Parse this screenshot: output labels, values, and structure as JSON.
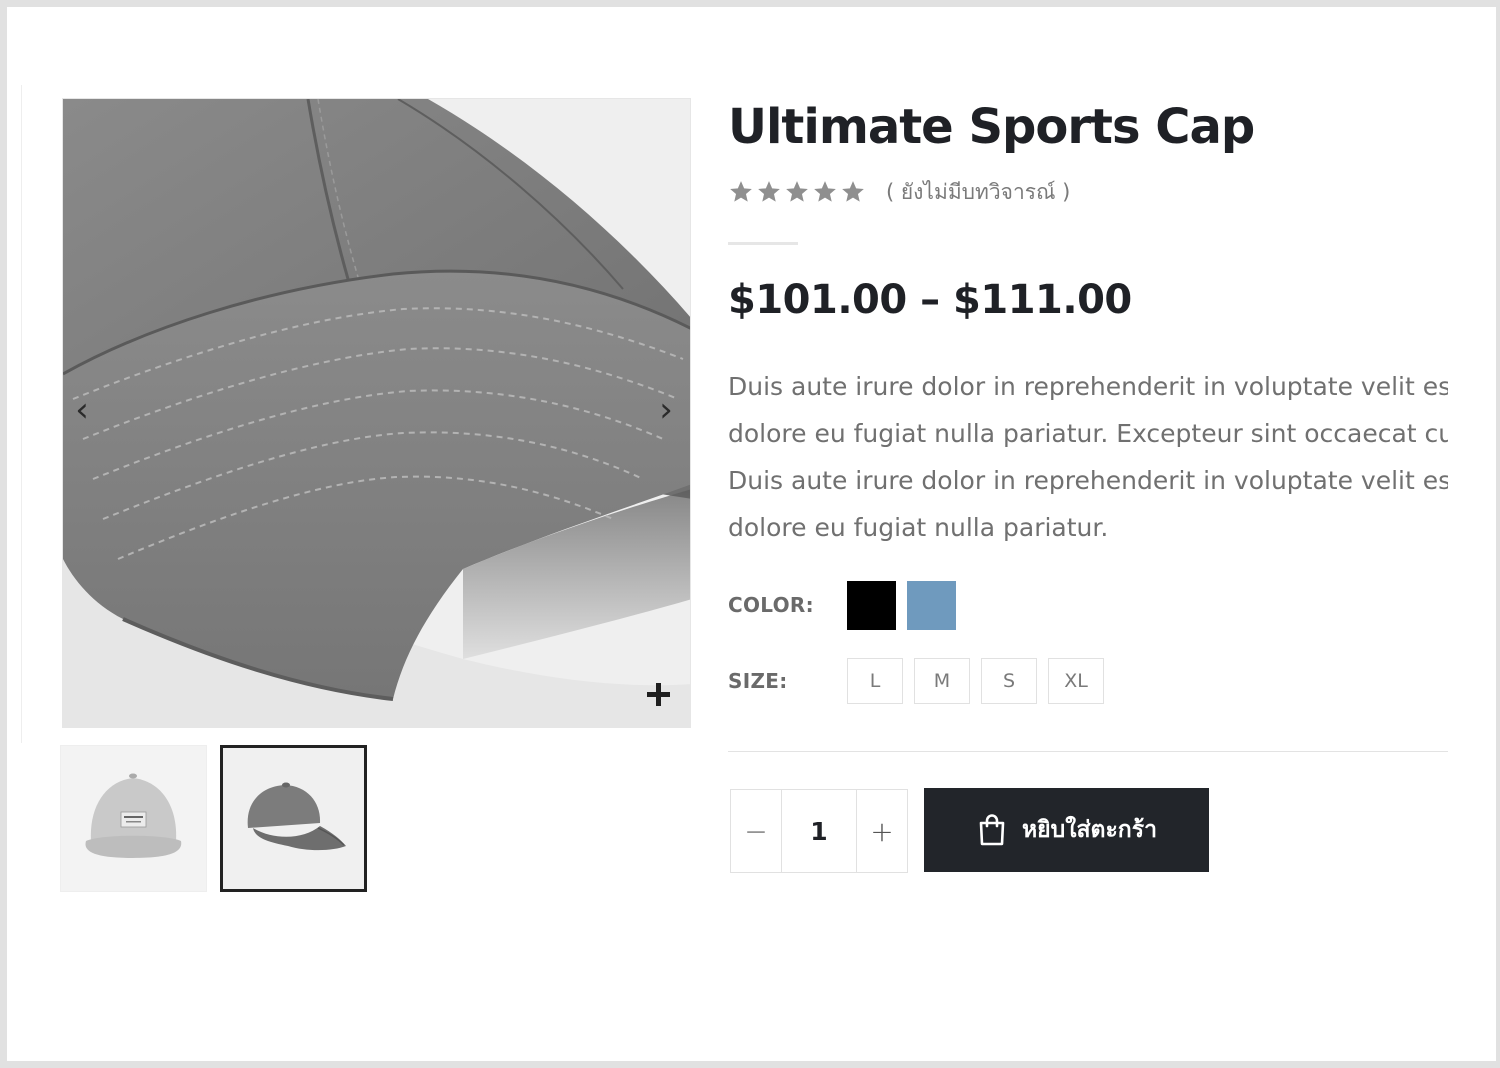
{
  "product": {
    "title": "Ultimate Sports Cap",
    "rating": 0,
    "rating_max": 5,
    "review_text": "( ยังไม่มีบทวิจารณ์ )",
    "price_range": "$101.00 – $111.00",
    "description_lines": [
      "Duis aute irure dolor in reprehenderit in voluptate velit esse cillum",
      "dolore eu fugiat nulla pariatur. Excepteur sint occaecat cupidatat non",
      "Duis aute irure dolor in reprehenderit in voluptate velit esse cillum",
      "dolore eu fugiat nulla pariatur."
    ]
  },
  "gallery": {
    "prev_icon": "chevron-left-icon",
    "next_icon": "chevron-right-icon",
    "zoom_icon": "plus-icon",
    "active_thumb": 2
  },
  "attributes": {
    "color_label": "COLOR:",
    "colors": [
      {
        "name": "black",
        "hex": "#000000"
      },
      {
        "name": "blue",
        "hex": "#6f9abe"
      }
    ],
    "size_label": "SIZE:",
    "sizes": [
      "L",
      "M",
      "S",
      "XL"
    ]
  },
  "cart": {
    "quantity": "1",
    "minus_label": "−",
    "plus_label": "+",
    "add_to_cart_label": "หยิบใส่ตะกร้า",
    "button_icon": "shopping-bag-icon"
  },
  "colors": {
    "title": "#1f2126",
    "text_muted": "#707070",
    "star": "#8f8f8f",
    "button_bg": "#22252a"
  }
}
